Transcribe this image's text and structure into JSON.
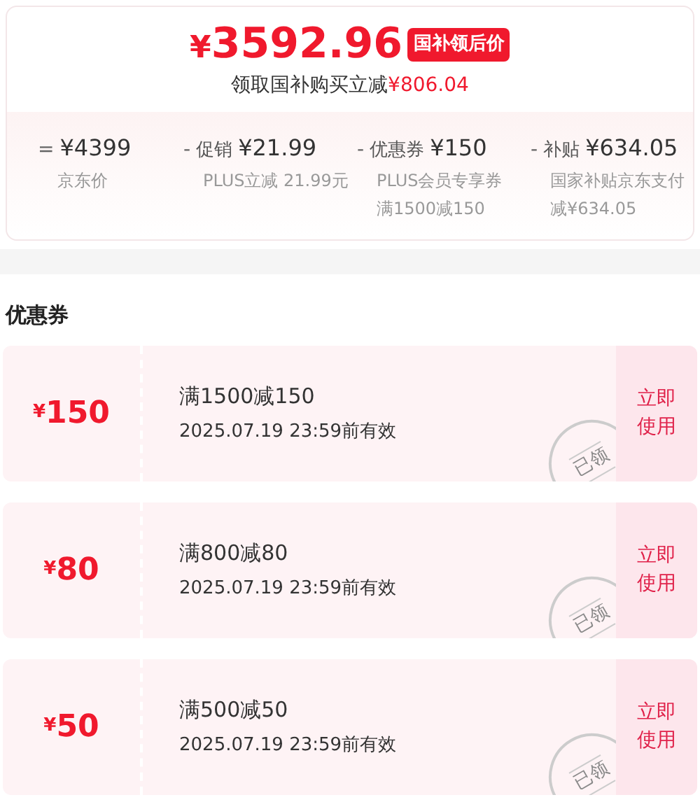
{
  "price": {
    "currency": "¥",
    "amount": "3592.96",
    "badge": "国补领后价",
    "subtitle": "领取国补购买立减",
    "saving": "¥806.04"
  },
  "breakdown": [
    {
      "sign": "=",
      "amount": "¥4399",
      "notes": [
        "京东价"
      ]
    },
    {
      "sign": "-",
      "label": "促销",
      "amount": "¥21.99",
      "notes": [
        "PLUS立减 21.99元"
      ]
    },
    {
      "sign": "-",
      "label": "优惠券",
      "amount": "¥150",
      "notes": [
        "PLUS会员专享券",
        "满1500减150"
      ]
    },
    {
      "sign": "-",
      "label": "补贴",
      "amount": "¥634.05",
      "notes": [
        "国家补贴京东支付",
        "减¥634.05"
      ]
    }
  ],
  "coupons_title": "优惠券",
  "coupons": [
    {
      "currency": "¥",
      "amount": "150",
      "condition": "满1500减150",
      "validity": "2025.07.19 23:59前有效",
      "claimed": true,
      "stamp": "已领",
      "action": "立即使用"
    },
    {
      "currency": "¥",
      "amount": "80",
      "condition": "满800减80",
      "validity": "2025.07.19 23:59前有效",
      "claimed": true,
      "stamp": "已领",
      "action": "立即使用"
    },
    {
      "currency": "¥",
      "amount": "50",
      "condition": "满500减50",
      "validity": "2025.07.19 23:59前有效",
      "claimed": true,
      "stamp": "已领",
      "action": "立即使用"
    }
  ]
}
